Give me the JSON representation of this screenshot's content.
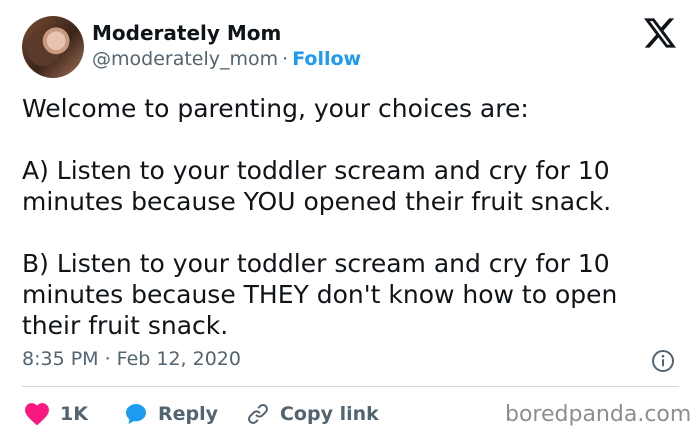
{
  "author": {
    "name": "Moderately Mom",
    "handle": "@moderately_mom",
    "separator": "·",
    "follow_label": "Follow"
  },
  "tweet": {
    "line1": "Welcome to parenting, your choices are:",
    "line2": "A) Listen to your toddler scream and cry for 10",
    "line3": "minutes because YOU opened their fruit snack.",
    "line4": "B) Listen to your toddler scream and cry for 10",
    "line5": "minutes because THEY don't know how to open",
    "line6": "their fruit snack."
  },
  "timestamp": "8:35 PM · Feb 12, 2020",
  "actions": {
    "likes_count": "1K",
    "reply_label": "Reply",
    "copy_link_label": "Copy link"
  },
  "watermark": "boredpanda.com",
  "colors": {
    "follow": "#1d9bf0",
    "heart": "#f91880",
    "reply_bubble": "#1d9bf0",
    "secondary_text": "#536471"
  },
  "icons": [
    "x-logo-icon",
    "info-icon",
    "heart-icon",
    "reply-icon",
    "link-icon"
  ]
}
